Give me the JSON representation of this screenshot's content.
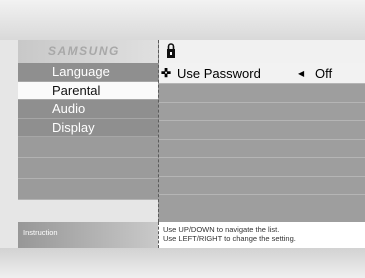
{
  "brand": "SAMSUNG",
  "menu": {
    "items": [
      {
        "label": "Language"
      },
      {
        "label": "Parental"
      },
      {
        "label": "Audio"
      },
      {
        "label": "Display"
      }
    ],
    "selected_index": 1
  },
  "parental": {
    "setting_label": "Use Password",
    "setting_value": "Off"
  },
  "instruction": {
    "label": "Instruction",
    "line1": "Use UP/DOWN to navigate the list.",
    "line2": "Use LEFT/RIGHT to change the setting."
  }
}
